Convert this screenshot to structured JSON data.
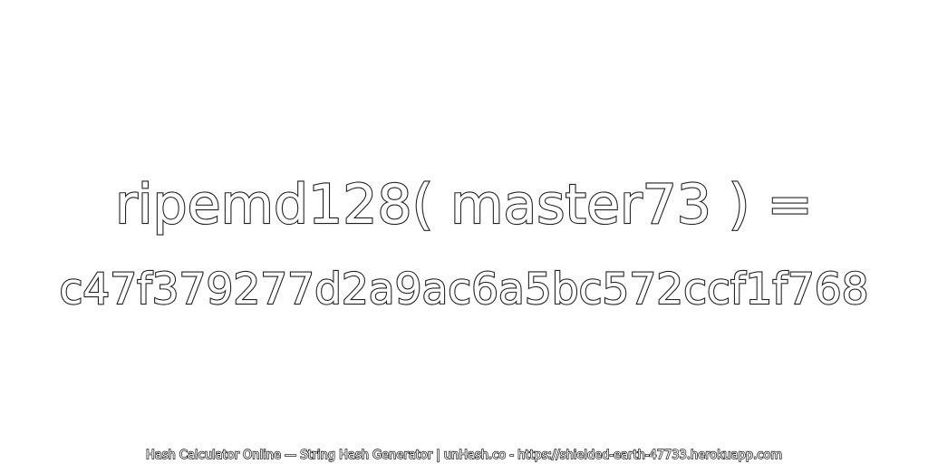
{
  "expression": "ripemd128( master73 ) =",
  "hash_value": "c47f379277d2a9ac6a5bc572ccf1f768",
  "footer_text": "Hash Calculator Online — String Hash Generator | unHash.co - https://shielded-earth-47733.herokuapp.com"
}
